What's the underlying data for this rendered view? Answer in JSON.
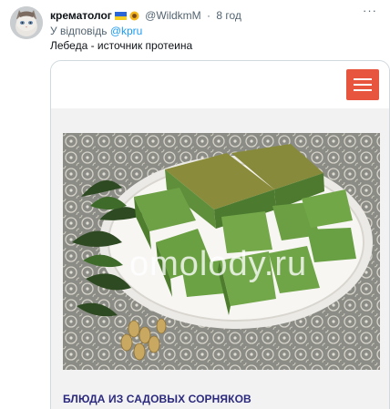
{
  "tweet": {
    "author_name": "крематолог",
    "handle": "@WildkmM",
    "separator": "·",
    "time": "8 год",
    "reply_prefix": "У відповідь",
    "reply_to": "@kpru",
    "text": "Лебеда - источник протеина"
  },
  "media": {
    "watermark": "omolody.ru",
    "article_title": "БЛЮДА ИЗ САДОВЫХ СОРНЯКОВ",
    "menu_icon": "hamburger-menu-icon"
  },
  "colors": {
    "menu_button": "#e8553f",
    "title": "#2c2a7e",
    "mention": "#1d9bf0",
    "secondary_text": "#536471"
  }
}
